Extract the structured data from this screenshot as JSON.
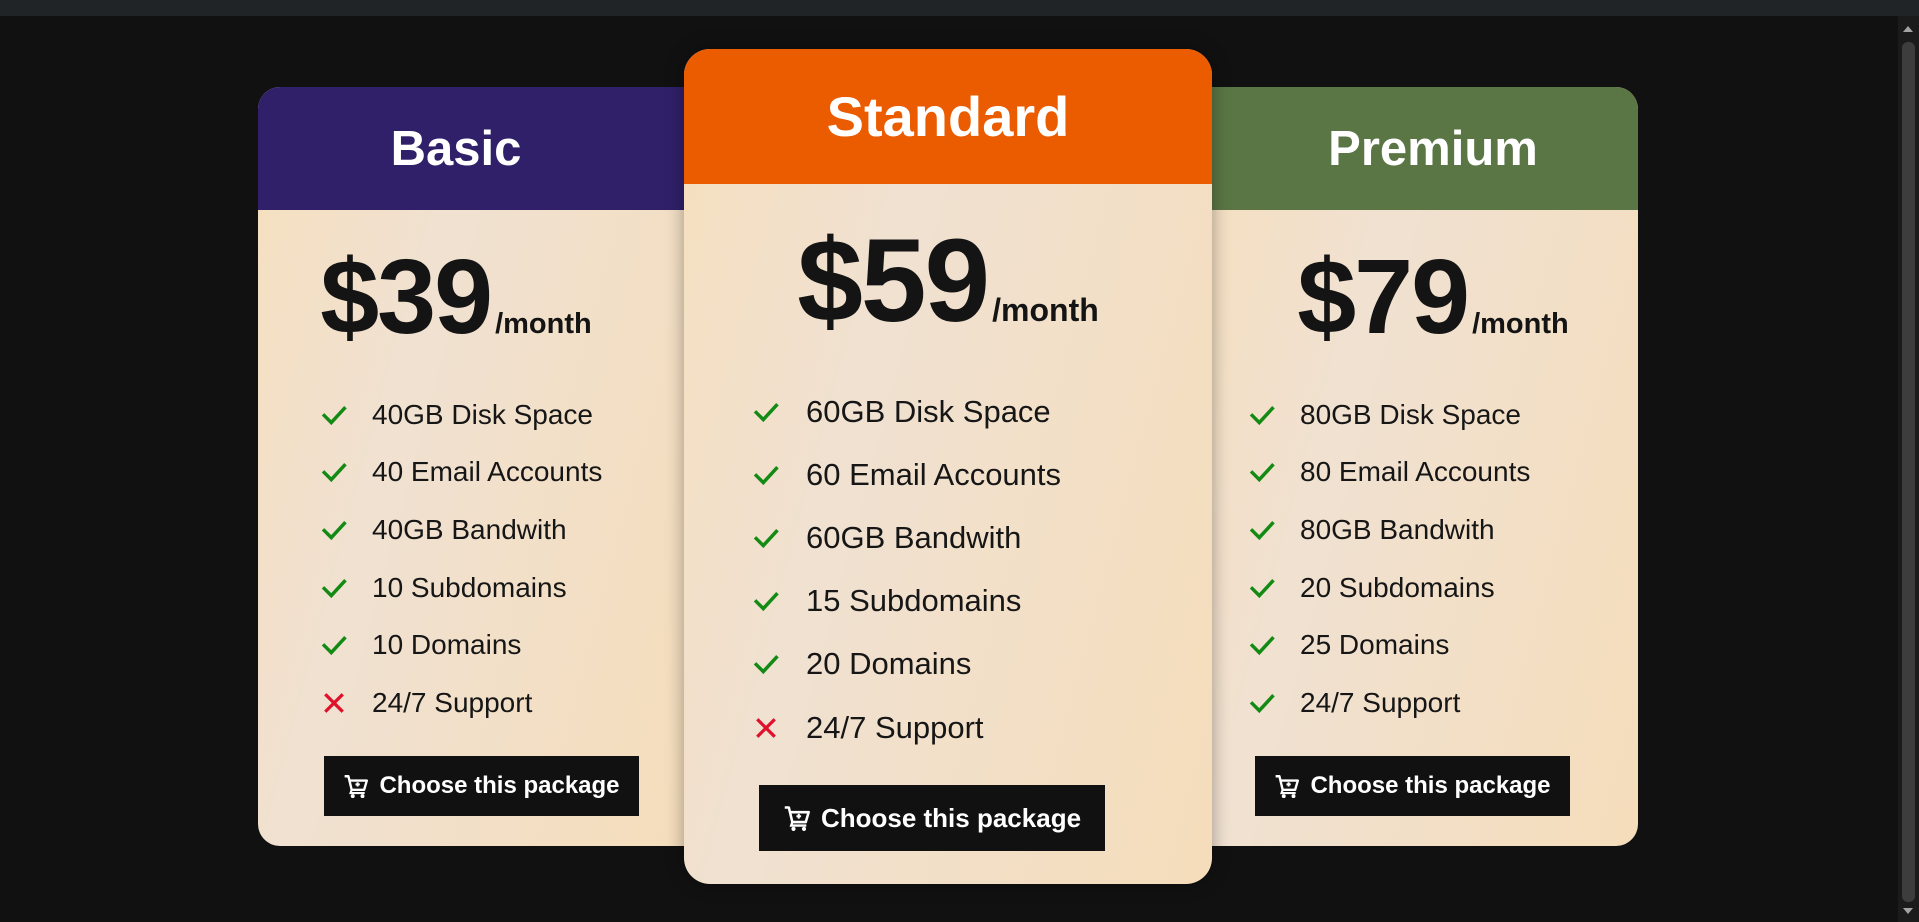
{
  "plans": [
    {
      "name": "Basic",
      "price": "$39",
      "period": "/month",
      "header_color": "#30206a",
      "features": [
        {
          "text": "40GB Disk Space",
          "included": true
        },
        {
          "text": "40 Email Accounts",
          "included": true
        },
        {
          "text": "40GB Bandwith",
          "included": true
        },
        {
          "text": "10 Subdomains",
          "included": true
        },
        {
          "text": "10 Domains",
          "included": true
        },
        {
          "text": "24/7 Support",
          "included": false
        }
      ],
      "button_label": "Choose this package"
    },
    {
      "name": "Standard",
      "price": "$59",
      "period": "/month",
      "header_color": "#eb5b00",
      "features": [
        {
          "text": "60GB Disk Space",
          "included": true
        },
        {
          "text": "60 Email Accounts",
          "included": true
        },
        {
          "text": "60GB Bandwith",
          "included": true
        },
        {
          "text": "15 Subdomains",
          "included": true
        },
        {
          "text": "20 Domains",
          "included": true
        },
        {
          "text": "24/7 Support",
          "included": false
        }
      ],
      "button_label": "Choose this package"
    },
    {
      "name": "Premium",
      "price": "$79",
      "period": "/month",
      "header_color": "#5b7645",
      "features": [
        {
          "text": "80GB Disk Space",
          "included": true
        },
        {
          "text": "80 Email Accounts",
          "included": true
        },
        {
          "text": "80GB Bandwith",
          "included": true
        },
        {
          "text": "20 Subdomains",
          "included": true
        },
        {
          "text": "25 Domains",
          "included": true
        },
        {
          "text": "24/7 Support",
          "included": true
        }
      ],
      "button_label": "Choose this package"
    }
  ],
  "icons": {
    "included": "check-icon",
    "excluded": "x-icon",
    "button": "cart-icon"
  },
  "colors": {
    "check": "#138a13",
    "cross": "#e0112b",
    "background": "#111111",
    "button": "#111111"
  }
}
